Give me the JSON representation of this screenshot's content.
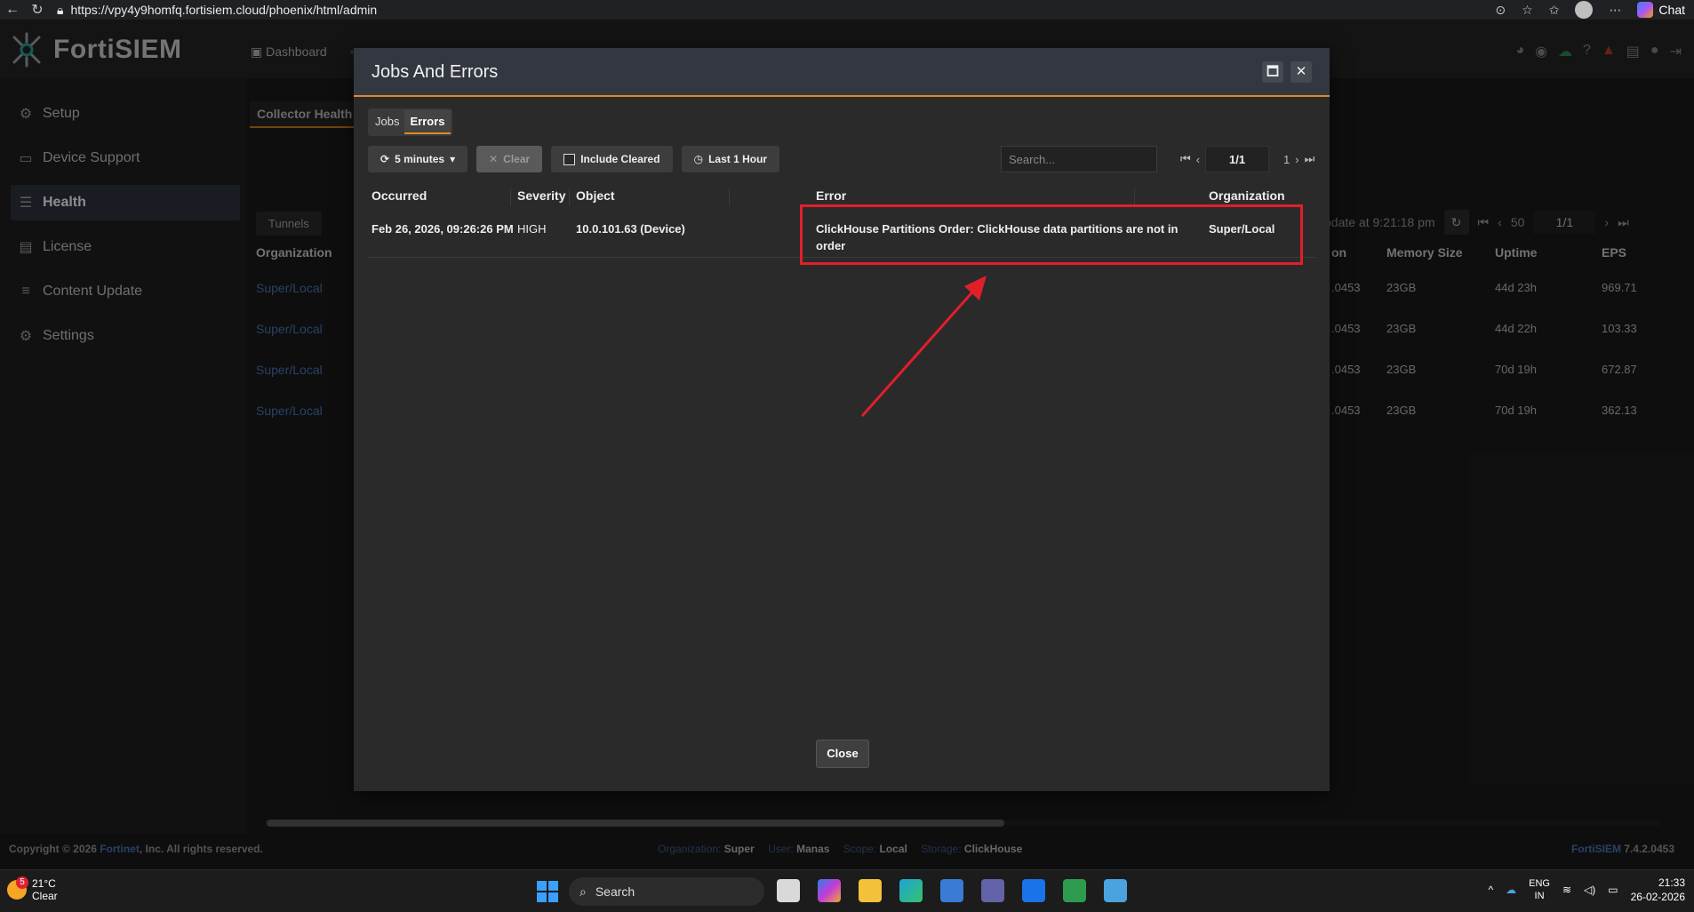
{
  "browser": {
    "url": "https://vpy4y9homfq.fortisiem.cloud/phoenix/html/admin",
    "chat_label": "Chat"
  },
  "app": {
    "logo_text": "FortiSIEM",
    "top_nav": [
      "Dashboard"
    ]
  },
  "sidebar": {
    "items": [
      {
        "label": "Setup",
        "icon": "gear-icon"
      },
      {
        "label": "Device Support",
        "icon": "hdd-icon"
      },
      {
        "label": "Health",
        "icon": "list-icon"
      },
      {
        "label": "License",
        "icon": "id-card-icon"
      },
      {
        "label": "Content Update",
        "icon": "database-icon"
      },
      {
        "label": "Settings",
        "icon": "gears-icon"
      }
    ]
  },
  "background": {
    "tab_label": "Collector Health",
    "tunnels_label": "Tunnels",
    "update_text": "pdate at 9:21:18 pm",
    "page_size": "50",
    "page": "1/1",
    "columns": {
      "org": "Organization",
      "ion": "on",
      "memory": "Memory Size",
      "uptime": "Uptime",
      "eps": "EPS"
    },
    "rows": [
      {
        "org": "Super/Local",
        "ion": ".0453",
        "memory": "23GB",
        "uptime": "44d 23h",
        "eps": "969.71"
      },
      {
        "org": "Super/Local",
        "ion": ".0453",
        "memory": "23GB",
        "uptime": "44d 22h",
        "eps": "103.33"
      },
      {
        "org": "Super/Local",
        "ion": ".0453",
        "memory": "23GB",
        "uptime": "70d 19h",
        "eps": "672.87"
      },
      {
        "org": "Super/Local",
        "ion": ".0453",
        "memory": "23GB",
        "uptime": "70d 19h",
        "eps": "362.13"
      }
    ]
  },
  "footer": {
    "copyright_prefix": "Copyright © 2026",
    "company": "Fortinet",
    "copyright_suffix": ", Inc. All rights reserved.",
    "org_label": "Organization:",
    "org_value": "Super",
    "user_label": "User:",
    "user_value": "Manas",
    "scope_label": "Scope:",
    "scope_value": "Local",
    "storage_label": "Storage:",
    "storage_value": "ClickHouse",
    "product": "FortiSIEM",
    "version": "7.4.2.0453"
  },
  "modal": {
    "title": "Jobs And Errors",
    "tabs": [
      {
        "label": "Jobs",
        "active": false
      },
      {
        "label": "Errors",
        "active": true
      }
    ],
    "toolbar": {
      "refresh_label": "5 minutes",
      "clear_label": "Clear",
      "include_cleared_label": "Include Cleared",
      "time_range_label": "Last 1 Hour"
    },
    "search_placeholder": "Search...",
    "pager": {
      "page": "1/1",
      "total": "1"
    },
    "columns": {
      "occurred": "Occurred",
      "severity": "Severity",
      "object": "Object",
      "error": "Error",
      "organization": "Organization"
    },
    "rows": [
      {
        "occurred": "Feb 26, 2026, 09:26:26 PM",
        "severity": "HIGH",
        "object": "10.0.101.63 (Device)",
        "error": "ClickHouse Partitions Order: ClickHouse data partitions are not in order",
        "organization": "Super/Local"
      }
    ],
    "close_label": "Close"
  },
  "taskbar": {
    "weather_temp": "21°C",
    "weather_desc": "Clear",
    "weather_badge": "5",
    "search_label": "Search",
    "lang_line1": "ENG",
    "lang_line2": "IN",
    "time": "21:33",
    "date": "26-02-2026"
  },
  "colors": {
    "accent": "#e08a2a",
    "highlight": "#e01f2a",
    "link": "#4a78b8"
  }
}
